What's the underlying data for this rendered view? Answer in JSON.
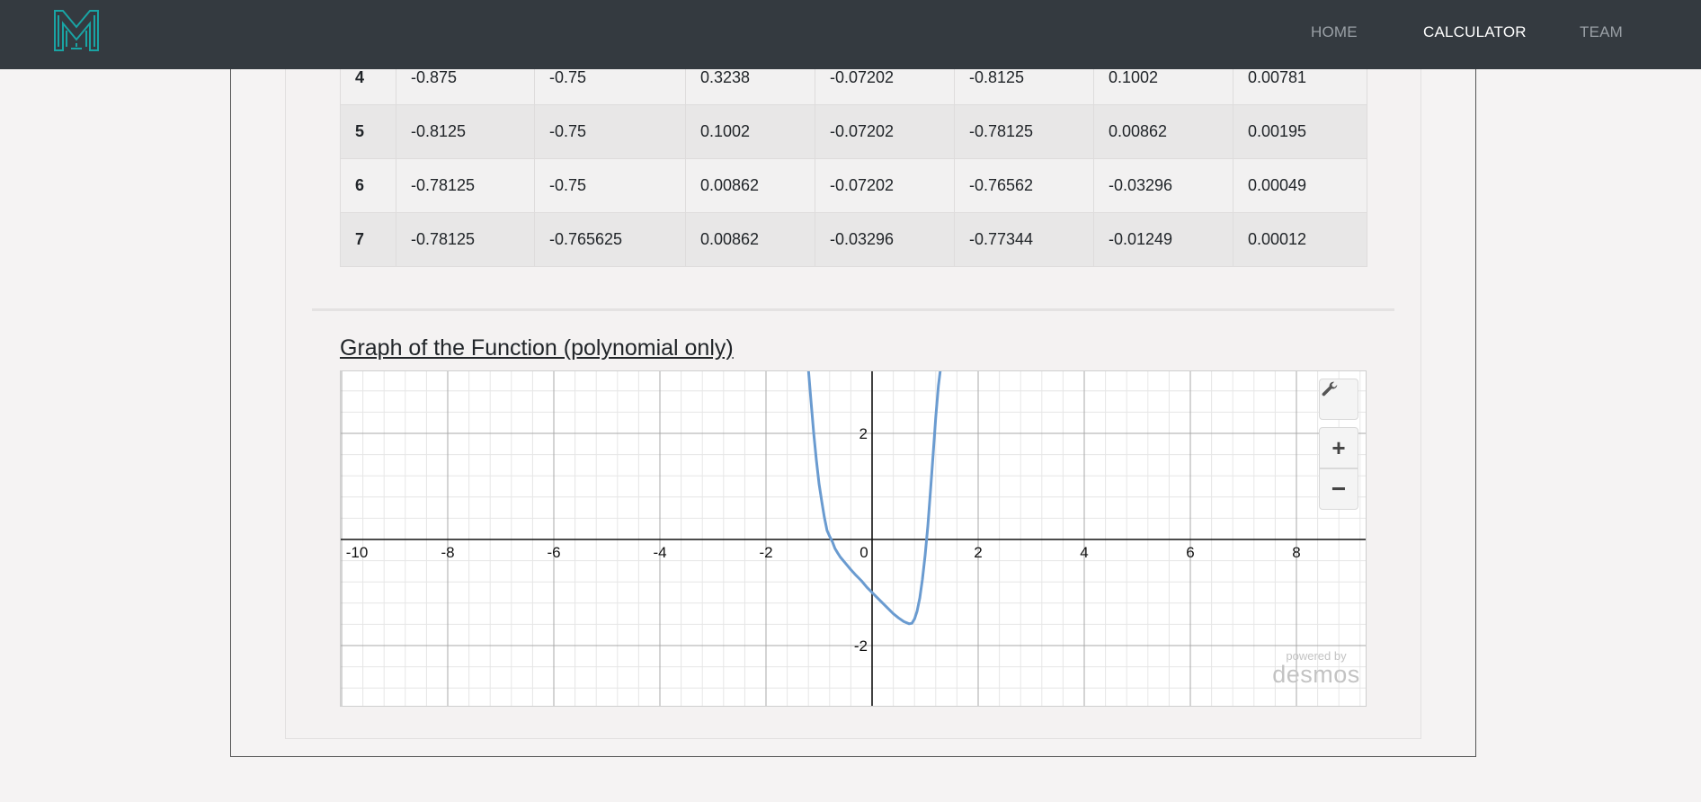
{
  "nav": {
    "logo": "M",
    "links": [
      "HOME",
      "CALCULATOR",
      "TEAM"
    ],
    "active": "CALCULATOR"
  },
  "table": {
    "rows": [
      [
        "4",
        "-0.875",
        "-0.75",
        "0.3238",
        "-0.07202",
        "-0.8125",
        "0.1002",
        "0.00781"
      ],
      [
        "5",
        "-0.8125",
        "-0.75",
        "0.1002",
        "-0.07202",
        "-0.78125",
        "0.00862",
        "0.00195"
      ],
      [
        "6",
        "-0.78125",
        "-0.75",
        "0.00862",
        "-0.07202",
        "-0.76562",
        "-0.03296",
        "0.00049"
      ],
      [
        "7",
        "-0.78125",
        "-0.765625",
        "0.00862",
        "-0.03296",
        "-0.77344",
        "-0.01249",
        "0.00012"
      ]
    ]
  },
  "graph": {
    "title": "Graph of the Function (polynomial only)",
    "x_ticks": [
      "-10",
      "-8",
      "-6",
      "-4",
      "-2",
      "0",
      "2",
      "4",
      "6",
      "8"
    ],
    "y_ticks": [
      "2",
      "-2"
    ],
    "controls": {
      "wrench": "wrench-icon",
      "zoom_in": "+",
      "zoom_out": "−"
    },
    "powered_by": "powered by",
    "brand": "desmos",
    "curve_color": "#6a9bd0"
  },
  "chart_data": {
    "type": "line",
    "xlim": [
      -10,
      9.3
    ],
    "ylim": [
      -3.2,
      3.2
    ],
    "grid": true,
    "series": [
      {
        "x": [
          -1.2,
          -1.15,
          -1.1,
          -1.05,
          -1.0,
          -0.95,
          -0.9,
          -0.85,
          -0.8,
          -0.75,
          -0.7,
          -0.65,
          -0.6,
          -0.5,
          -0.4,
          -0.3,
          -0.2,
          -0.1,
          0.0,
          0.1,
          0.2,
          0.3,
          0.4,
          0.5,
          0.6,
          0.7,
          0.75,
          0.8,
          0.85,
          0.9,
          0.95,
          1.0,
          1.05,
          1.1,
          1.15,
          1.2,
          1.25,
          1.3
        ],
        "y": [
          3.2,
          2.6,
          2.0,
          1.5,
          1.05,
          0.72,
          0.42,
          0.17,
          0.06,
          -0.04,
          -0.17,
          -0.25,
          -0.33,
          -0.45,
          -0.57,
          -0.68,
          -0.78,
          -0.9,
          -1.0,
          -1.1,
          -1.2,
          -1.3,
          -1.4,
          -1.48,
          -1.55,
          -1.59,
          -1.58,
          -1.5,
          -1.35,
          -1.1,
          -0.75,
          -0.3,
          0.25,
          0.9,
          1.6,
          2.3,
          2.9,
          3.3
        ]
      }
    ]
  }
}
